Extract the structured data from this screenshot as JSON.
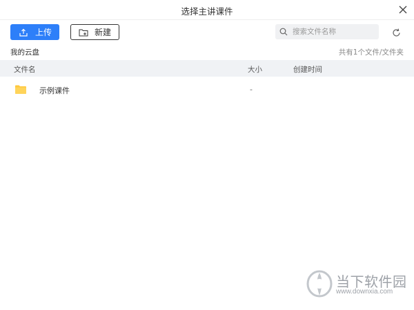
{
  "dialog": {
    "title": "选择主讲课件"
  },
  "toolbar": {
    "upload_label": "上传",
    "new_label": "新建",
    "search_placeholder": "搜索文件名称"
  },
  "breadcrumb": {
    "current": "我的云盘",
    "summary": "共有1个文件/文件夹"
  },
  "table": {
    "headers": {
      "name": "文件名",
      "size": "大小",
      "created": "创建时间"
    },
    "rows": [
      {
        "icon": "folder-icon",
        "name": "示例课件",
        "size": "-",
        "created": ""
      }
    ]
  },
  "watermark": {
    "brand": "当下软件园",
    "url": "www.downxia.com"
  },
  "colors": {
    "accent": "#2d7ff9",
    "header_bg": "#f0f2f5",
    "folder": "#ffc83d"
  }
}
